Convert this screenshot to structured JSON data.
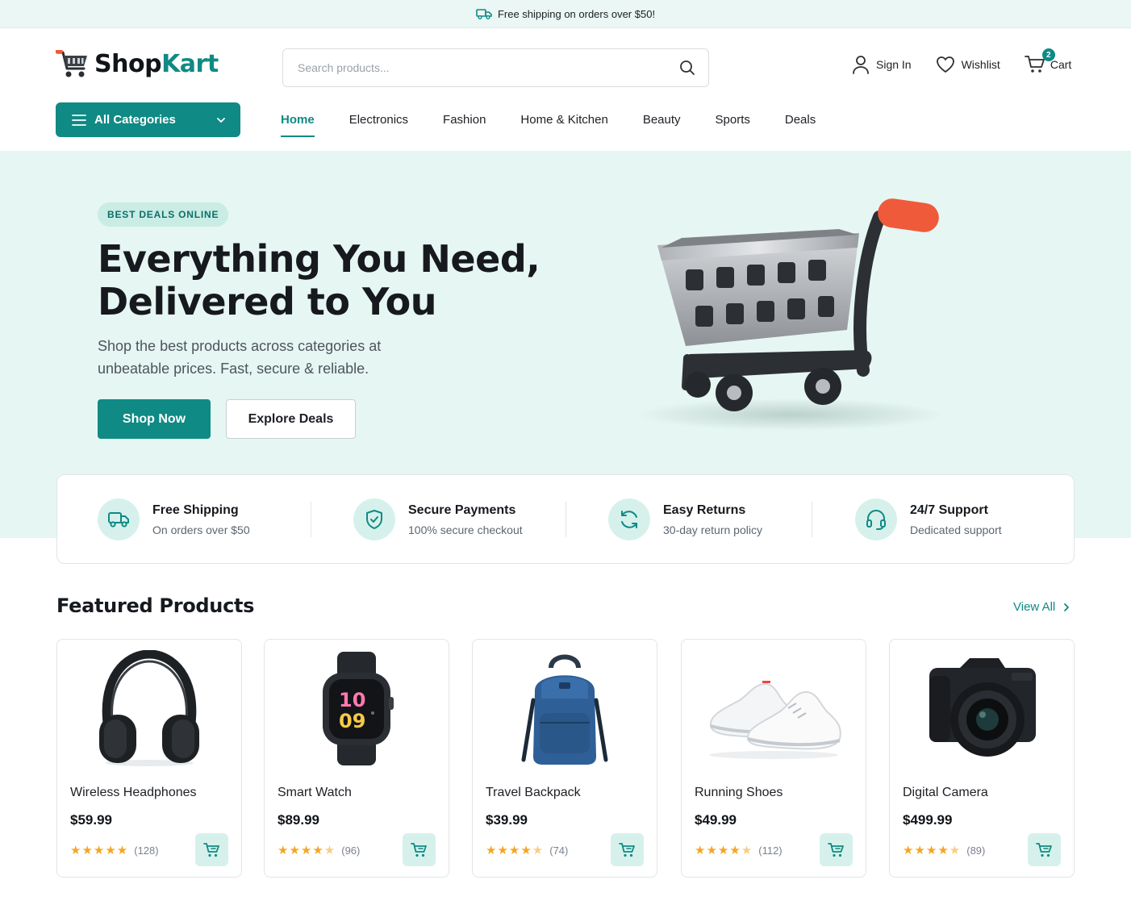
{
  "promo": {
    "text": "Free shipping on orders over $50!"
  },
  "header": {
    "logo_part1": "Shop",
    "logo_part2": "Kart",
    "search_placeholder": "Search products...",
    "sign_in": "Sign In",
    "wishlist": "Wishlist",
    "cart": "Cart",
    "cart_count": "2"
  },
  "nav": {
    "categories_label": "All Categories",
    "items": [
      "Home",
      "Electronics",
      "Fashion",
      "Home & Kitchen",
      "Beauty",
      "Sports",
      "Deals"
    ],
    "active": "Home"
  },
  "hero": {
    "badge": "BEST DEALS ONLINE",
    "title_line1": "Everything You Need,",
    "title_line2": "Delivered to You",
    "subtitle_line1": "Shop the best products across categories at",
    "subtitle_line2": "unbeatable prices. Fast, secure & reliable.",
    "primary_cta": "Shop Now",
    "secondary_cta": "Explore Deals"
  },
  "features": [
    {
      "icon": "truck-icon",
      "title": "Free Shipping",
      "desc": "On orders over $50"
    },
    {
      "icon": "shield-icon",
      "title": "Secure Payments",
      "desc": "100% secure checkout"
    },
    {
      "icon": "refresh-icon",
      "title": "Easy Returns",
      "desc": "30-day return policy"
    },
    {
      "icon": "headset-icon",
      "title": "24/7 Support",
      "desc": "Dedicated support"
    }
  ],
  "featured": {
    "title": "Featured Products",
    "view_all": "View All",
    "products": [
      {
        "name": "Wireless Headphones",
        "price": "$59.99",
        "rating": 5,
        "reviews": "(128)",
        "image": "headphones-image"
      },
      {
        "name": "Smart Watch",
        "price": "$89.99",
        "rating": 4.5,
        "reviews": "(96)",
        "image": "smartwatch-image"
      },
      {
        "name": "Travel Backpack",
        "price": "$39.99",
        "rating": 4.5,
        "reviews": "(74)",
        "image": "backpack-image"
      },
      {
        "name": "Running Shoes",
        "price": "$49.99",
        "rating": 4.5,
        "reviews": "(112)",
        "image": "shoes-image"
      },
      {
        "name": "Digital Camera",
        "price": "$499.99",
        "rating": 4.5,
        "reviews": "(89)",
        "image": "camera-image"
      }
    ]
  },
  "colors": {
    "accent": "#0f8a84",
    "hero_bg": "#e6f6f2",
    "star": "#f5a623",
    "cart_handle": "#ef5a3a"
  }
}
